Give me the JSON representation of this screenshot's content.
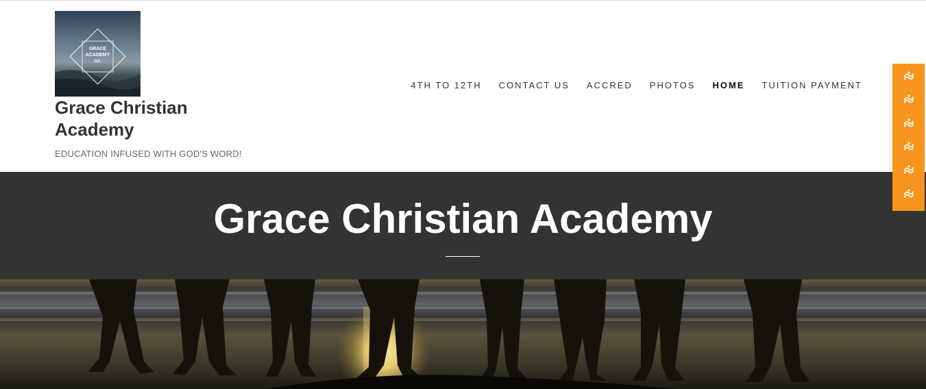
{
  "site": {
    "title": "Grace Christian Academy",
    "tagline": "EDUCATION INFUSED WITH GOD'S WORD!",
    "logo": {
      "text_lines": [
        "GRACE",
        "ACADEMY",
        "GA."
      ],
      "alt": "Grace Academy GA. logo"
    }
  },
  "nav": {
    "items": [
      {
        "label": "4TH TO 12TH",
        "active": false
      },
      {
        "label": "CONTACT US",
        "active": false
      },
      {
        "label": "ACCRED",
        "active": false
      },
      {
        "label": "PHOTOS",
        "active": false
      },
      {
        "label": "HOME",
        "active": true
      },
      {
        "label": "TUITION PAYMENT",
        "active": false
      }
    ]
  },
  "social_bar": {
    "color": "#f7941d",
    "icons": [
      "share-icon",
      "share-icon",
      "share-icon",
      "share-icon",
      "share-icon",
      "share-icon"
    ]
  },
  "banner": {
    "title": "Grace Christian Academy",
    "background": "#333333"
  },
  "hero": {
    "image": "people-silhouettes-on-beach-at-sunset"
  }
}
